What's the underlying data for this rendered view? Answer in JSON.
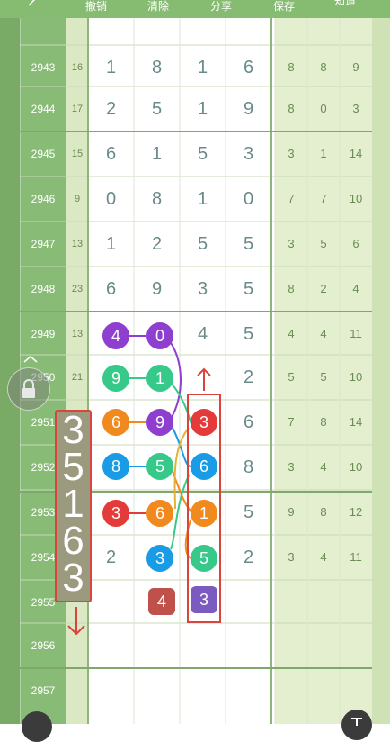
{
  "toolbar": {
    "buttons": [
      "撤销",
      "清除",
      "分享",
      "保存",
      "知道"
    ]
  },
  "rows": [
    {
      "issue": "2943",
      "sum": "16",
      "nums": [
        "1",
        "8",
        "1",
        "6"
      ],
      "right": [
        "8",
        "8",
        "9"
      ]
    },
    {
      "issue": "2944",
      "sum": "17",
      "nums": [
        "2",
        "5",
        "1",
        "9"
      ],
      "right": [
        "8",
        "0",
        "3"
      ]
    },
    {
      "issue": "2945",
      "sum": "15",
      "nums": [
        "6",
        "1",
        "5",
        "3"
      ],
      "right": [
        "3",
        "1",
        "14"
      ]
    },
    {
      "issue": "2946",
      "sum": "9",
      "nums": [
        "0",
        "8",
        "1",
        "0"
      ],
      "right": [
        "7",
        "7",
        "10"
      ]
    },
    {
      "issue": "2947",
      "sum": "13",
      "nums": [
        "1",
        "2",
        "5",
        "5"
      ],
      "right": [
        "3",
        "5",
        "6"
      ]
    },
    {
      "issue": "2948",
      "sum": "23",
      "nums": [
        "6",
        "9",
        "3",
        "5"
      ],
      "right": [
        "8",
        "2",
        "4"
      ]
    },
    {
      "issue": "2949",
      "sum": "13",
      "nums": [
        "",
        "",
        "4",
        "5"
      ],
      "right": [
        "4",
        "4",
        "11"
      ]
    },
    {
      "issue": "2950",
      "sum": "21",
      "nums": [
        "",
        "",
        "",
        "2"
      ],
      "right": [
        "5",
        "5",
        "10"
      ]
    },
    {
      "issue": "2951",
      "sum": "",
      "nums": [
        "",
        "",
        "",
        "6"
      ],
      "right": [
        "7",
        "8",
        "14"
      ]
    },
    {
      "issue": "2952",
      "sum": "",
      "nums": [
        "",
        "",
        "",
        "8"
      ],
      "right": [
        "3",
        "4",
        "10"
      ]
    },
    {
      "issue": "2953",
      "sum": "",
      "nums": [
        "",
        "",
        "",
        "5"
      ],
      "right": [
        "9",
        "8",
        "12"
      ]
    },
    {
      "issue": "2954",
      "sum": "",
      "nums": [
        "2",
        "",
        "",
        "2"
      ],
      "right": [
        "3",
        "4",
        "11"
      ]
    },
    {
      "issue": "2955",
      "sum": "",
      "nums": [
        "",
        "",
        "",
        ""
      ],
      "right": [
        "",
        "",
        ""
      ]
    },
    {
      "issue": "2956",
      "sum": "",
      "nums": [
        "",
        "",
        "",
        ""
      ],
      "right": [
        "",
        "",
        ""
      ]
    },
    {
      "issue": "2957",
      "sum": "",
      "nums": [
        "",
        "",
        "",
        ""
      ],
      "right": [
        "",
        "",
        ""
      ]
    }
  ],
  "balls": [
    {
      "n": "4",
      "color": "#8e3fd0"
    },
    {
      "n": "0",
      "color": "#8e3fd0"
    },
    {
      "n": "9",
      "color": "#36c98a"
    },
    {
      "n": "1",
      "color": "#36c98a"
    },
    {
      "n": "6",
      "color": "#f0891e"
    },
    {
      "n": "9",
      "color": "#8e3fd0"
    },
    {
      "n": "3",
      "color": "#e53a3a"
    },
    {
      "n": "8",
      "color": "#1a9be6"
    },
    {
      "n": "5",
      "color": "#36c98a"
    },
    {
      "n": "6",
      "color": "#1a9be6"
    },
    {
      "n": "3",
      "color": "#e53a3a"
    },
    {
      "n": "6",
      "color": "#f0891e"
    },
    {
      "n": "1",
      "color": "#f0891e"
    },
    {
      "n": "3",
      "color": "#1a9be6"
    },
    {
      "n": "5",
      "color": "#36c98a"
    },
    {
      "n": "4",
      "color": "#c0504a"
    },
    {
      "n": "3",
      "color": "#7b5bc0"
    }
  ],
  "big_column_digits": [
    "3",
    "5",
    "1",
    "6",
    "3"
  ],
  "colors": {
    "header": "#86bb72",
    "issue_col": "#88bc76",
    "sum_col": "#dbe8c4",
    "right_col": "#e3efcf",
    "accent_red": "#d9453c"
  }
}
